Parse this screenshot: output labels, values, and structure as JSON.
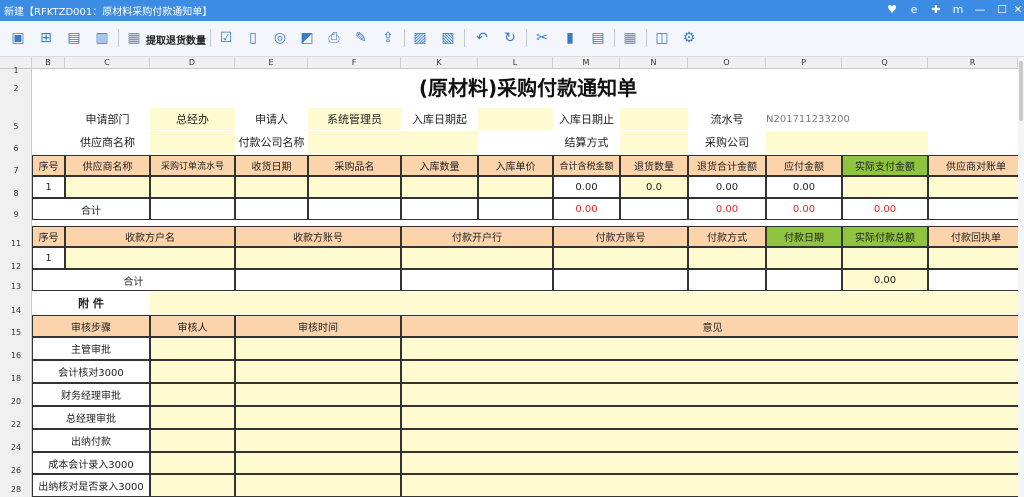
{
  "window": {
    "title": "新建【RFKTZD001：原材料采购付款通知单】"
  },
  "toolbar": {
    "fetch_return_label": "提取退货数量"
  },
  "columns": [
    "B",
    "C",
    "D",
    "E",
    "F",
    "K",
    "L",
    "M",
    "N",
    "O",
    "P",
    "Q",
    "R"
  ],
  "rows": [
    "1",
    "2",
    "5",
    "6",
    "7",
    "8",
    "9",
    "11",
    "12",
    "13",
    "14",
    "15",
    "16",
    "18",
    "20",
    "22",
    "24",
    "26",
    "28"
  ],
  "form": {
    "title": "(原材料)采购付款通知单",
    "apply_dept_label": "申请部门",
    "apply_dept_value": "总经办",
    "applicant_label": "申请人",
    "applicant_value": "系统管理员",
    "stock_date_from_label": "入库日期起",
    "stock_date_to_label": "入库日期止",
    "serial_label": "流水号",
    "serial_value": "N201711233200",
    "supplier_label": "供应商名称",
    "payer_company_label": "付款公司名称",
    "settle_label": "结算方式",
    "purchase_company_label": "采购公司"
  },
  "table1": {
    "headers": [
      "序号",
      "供应商名称",
      "采购订单流水号",
      "收货日期",
      "采购品名",
      "入库数量",
      "入库单价",
      "合计含税金额",
      "退货数量",
      "退货合计金额",
      "应付金额",
      "实际支付金额",
      "供应商对账单"
    ],
    "row1": {
      "idx": "1",
      "total_tax": "0.00",
      "return_qty": "0.0",
      "return_total": "0.00",
      "payable": "0.00"
    },
    "sum": {
      "label": "合计",
      "total_tax": "0.00",
      "return_total": "0.00",
      "payable": "0.00",
      "actual": "0.00"
    }
  },
  "table2": {
    "headers": [
      "序号",
      "收款方户名",
      "收款方账号",
      "付款开户行",
      "付款方账号",
      "付款方式",
      "付款日期",
      "实际付款总额",
      "付款回执单"
    ],
    "row1": {
      "idx": "1"
    },
    "sum": {
      "label": "合计",
      "actual_total": "0.00"
    }
  },
  "attachment": {
    "label": "附    件"
  },
  "approval": {
    "headers": [
      "审核步骤",
      "审核人",
      "审核时间",
      "意见"
    ],
    "steps": [
      "主管审批",
      "会计核对3000",
      "财务经理审批",
      "总经理审批",
      "出纳付款",
      "成本会计录入3000",
      "出纳核对是否录入3000"
    ]
  },
  "colors": {
    "titlebar": "#3c8ce3",
    "header_orange": "#fcd4ac",
    "header_green": "#8fc43e",
    "input_yellow": "#fffbd0",
    "value_red": "#d9262e"
  }
}
